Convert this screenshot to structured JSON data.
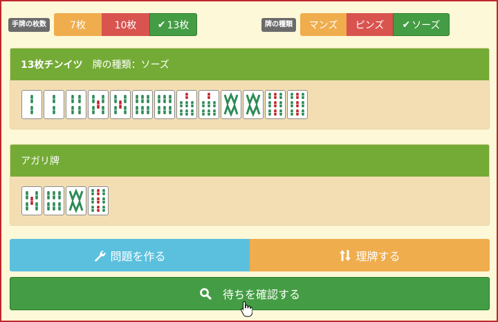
{
  "tile_count_selector": {
    "label": "手牌の枚数",
    "options": [
      {
        "label": "7枚",
        "selected": false,
        "color": "#efad4d"
      },
      {
        "label": "10枚",
        "selected": false,
        "color": "#d9534f"
      },
      {
        "label": "13枚",
        "selected": true,
        "color": "#449d44"
      }
    ]
  },
  "tile_type_selector": {
    "label": "牌の種類",
    "options": [
      {
        "label": "マンズ",
        "selected": false,
        "color": "#efad4d"
      },
      {
        "label": "ピンズ",
        "selected": false,
        "color": "#d9534f"
      },
      {
        "label": "ソーズ",
        "selected": true,
        "color": "#449d44"
      }
    ]
  },
  "hand_panel": {
    "title_count": "13枚チンイツ",
    "title_type": "牌の種類：ソーズ",
    "tiles": [
      "2s",
      "2s",
      "4s",
      "5s",
      "5s",
      "6s",
      "6s",
      "7s",
      "7s",
      "8s",
      "8s",
      "9s",
      "9s"
    ]
  },
  "winning_panel": {
    "title": "アガリ牌",
    "tiles": [
      "5s",
      "6s",
      "8s",
      "9s"
    ]
  },
  "actions": {
    "make_problem_label": "問題を作る",
    "sort_label": "理牌する",
    "check_wait_label": "待ちを確認する"
  },
  "colors": {
    "background": "#fdf8d8",
    "border": "#c0262c",
    "panel_header": "#74ab36",
    "panel_body": "#f3deb4",
    "bamboo_green": "#2e8b57",
    "bamboo_red": "#c0262c",
    "make_problem_button": "#5bc0de",
    "sort_button": "#efad4d",
    "check_button": "#449d44"
  }
}
